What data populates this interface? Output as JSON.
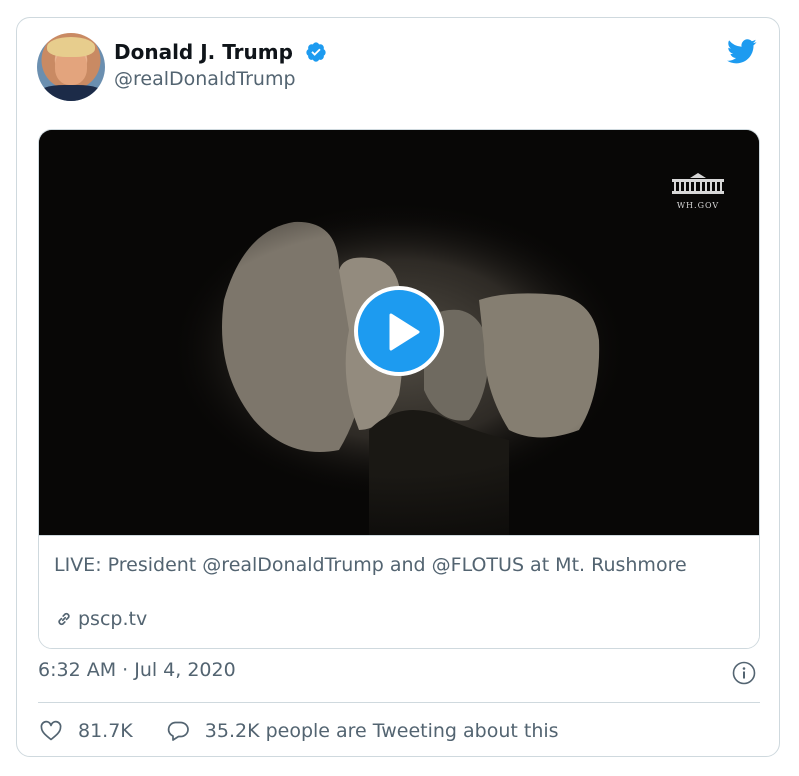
{
  "tweet": {
    "author_name": "Donald J. Trump",
    "author_handle": "@realDonaldTrump",
    "timestamp": "6:32 AM · Jul 4, 2020"
  },
  "media": {
    "watermark": "WH.GOV",
    "link_title": "LIVE: President @realDonaldTrump and @FLOTUS at Mt. Rushmore",
    "link_domain": "pscp.tv"
  },
  "actions": {
    "likes": "81.7K",
    "replies_label": "35.2K people are Tweeting about this"
  },
  "icons": {
    "verified": "verified-badge-icon",
    "brand": "twitter-bird-icon",
    "play": "play-icon",
    "link": "link-icon",
    "info": "info-icon",
    "like": "heart-icon",
    "reply": "comment-icon"
  },
  "colors": {
    "accent": "#1d9bf0",
    "muted_text": "#536471",
    "border": "#cfd9de"
  }
}
